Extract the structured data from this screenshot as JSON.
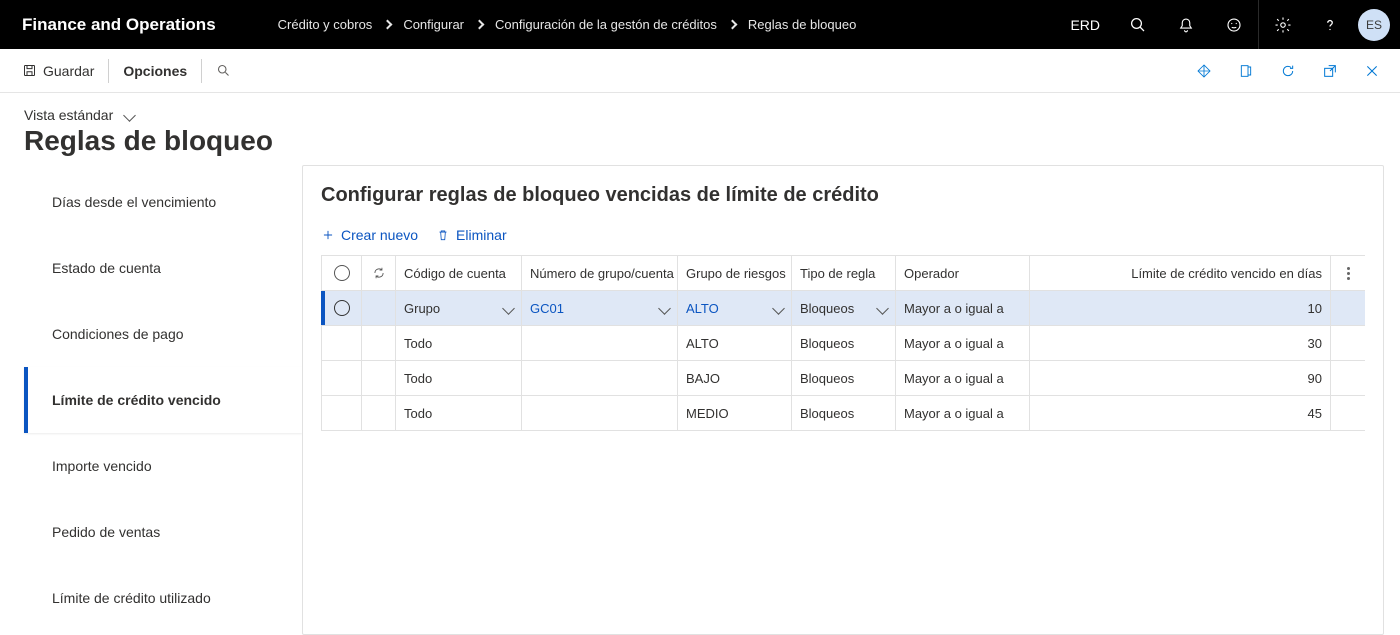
{
  "brand": "Finance and Operations",
  "breadcrumb": [
    "Crédito y cobros",
    "Configurar",
    "Configuración de la gestón de créditos",
    "Reglas de bloqueo"
  ],
  "company_code": "ERD",
  "avatar_initials": "ES",
  "action_bar": {
    "save_label": "Guardar",
    "options_label": "Opciones"
  },
  "page": {
    "view_label": "Vista estándar",
    "title": "Reglas de bloqueo"
  },
  "sidebar": {
    "items": [
      {
        "label": "Días desde el vencimiento"
      },
      {
        "label": "Estado de cuenta"
      },
      {
        "label": "Condiciones de pago"
      },
      {
        "label": "Límite de crédito vencido"
      },
      {
        "label": "Importe vencido"
      },
      {
        "label": "Pedido de ventas"
      },
      {
        "label": "Límite de crédito utilizado"
      }
    ],
    "active_index": 3
  },
  "panel": {
    "title": "Configurar reglas de bloqueo vencidas de límite de crédito",
    "create_label": "Crear nuevo",
    "delete_label": "Eliminar"
  },
  "grid": {
    "columns": {
      "account_code": "Código de cuenta",
      "group_number": "Número de grupo/cuenta",
      "risk_group": "Grupo de riesgos",
      "rule_type": "Tipo de regla",
      "operator": "Operador",
      "limit_days": "Límite de crédito vencido en días"
    },
    "rows": [
      {
        "selected": true,
        "account_code": "Grupo",
        "group_number": "GC01",
        "risk_group": "ALTO",
        "rule_type": "Bloqueos",
        "operator": "Mayor a o igual a",
        "limit_days": "10"
      },
      {
        "selected": false,
        "account_code": "Todo",
        "group_number": "",
        "risk_group": "ALTO",
        "rule_type": "Bloqueos",
        "operator": "Mayor a o igual a",
        "limit_days": "30"
      },
      {
        "selected": false,
        "account_code": "Todo",
        "group_number": "",
        "risk_group": "BAJO",
        "rule_type": "Bloqueos",
        "operator": "Mayor a o igual a",
        "limit_days": "90"
      },
      {
        "selected": false,
        "account_code": "Todo",
        "group_number": "",
        "risk_group": "MEDIO",
        "rule_type": "Bloqueos",
        "operator": "Mayor a o igual a",
        "limit_days": "45"
      }
    ]
  }
}
